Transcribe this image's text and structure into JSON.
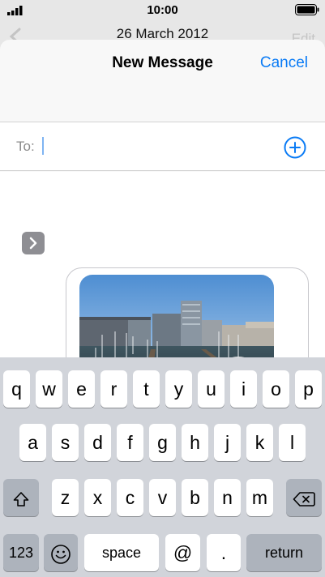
{
  "status_bar": {
    "time": "10:00"
  },
  "underlay": {
    "date": "26 March 2012",
    "edit_label": "Edit"
  },
  "compose": {
    "title": "New Message",
    "cancel_label": "Cancel",
    "to_label": "To:",
    "to_value": ""
  },
  "message": {
    "attachment_icon": "photo-attachment"
  },
  "keyboard": {
    "row1": [
      "q",
      "w",
      "e",
      "r",
      "t",
      "y",
      "u",
      "i",
      "o",
      "p"
    ],
    "row2": [
      "a",
      "s",
      "d",
      "f",
      "g",
      "h",
      "j",
      "k",
      "l"
    ],
    "row3": [
      "z",
      "x",
      "c",
      "v",
      "b",
      "n",
      "m"
    ],
    "numbers_label": "123",
    "space_label": "space",
    "at_label": "@",
    "period_label": ".",
    "return_label": "return"
  },
  "colors": {
    "accent": "#0a7bf5",
    "keyboard_bg": "#d1d4da",
    "special_key": "#adb3bc"
  }
}
